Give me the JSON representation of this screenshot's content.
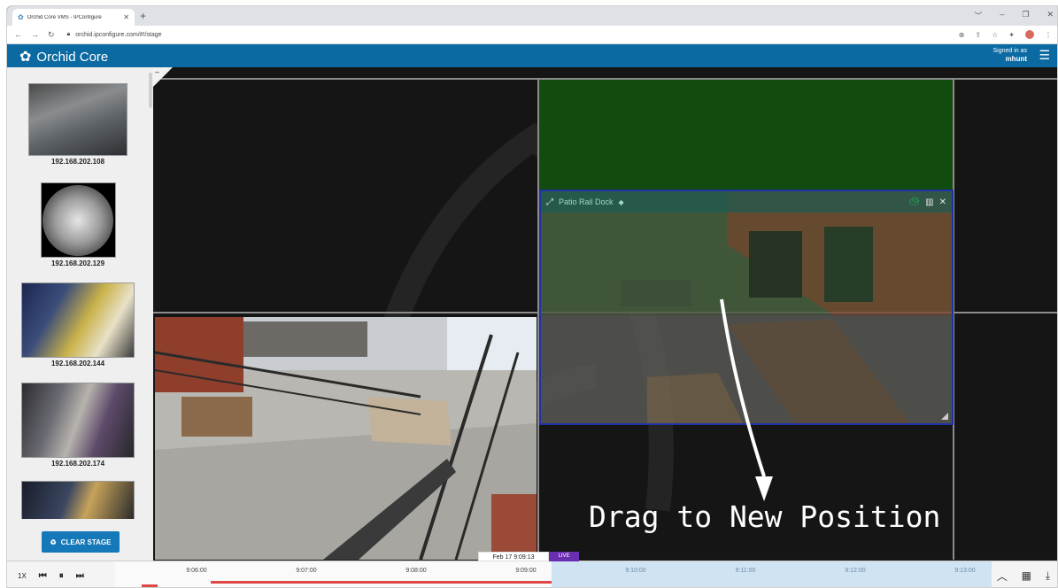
{
  "browser": {
    "tab_title": "Orchid Core VMS - IPConfigure",
    "url": "orchid.ipconfigure.com/#!/stage"
  },
  "header": {
    "brand": "Orchid Core",
    "signed_in_label": "Signed in as",
    "username": "mhunt"
  },
  "sidebar": {
    "cameras": [
      {
        "label": "192.168.202.108"
      },
      {
        "label": "192.168.202.129"
      },
      {
        "label": "192.168.202.144"
      },
      {
        "label": "192.168.202.174"
      },
      {
        "label": ""
      }
    ],
    "clear_stage_label": "CLEAR STAGE"
  },
  "stage": {
    "drag_tile_title": "Patio Rail Dock",
    "annotation": "Drag to New Position"
  },
  "timeline": {
    "speed": "1X",
    "current_datetime": "Feb 17 9:09:13",
    "live_label": "LIVE",
    "ticks": [
      "9:06:00",
      "9:07:00",
      "9:08:00",
      "9:09:00",
      "9:10:00",
      "9:11:00",
      "9:12:00",
      "9:13:00"
    ]
  },
  "colors": {
    "header_bg": "#0b6aa2",
    "live_badge": "#6a2fb0",
    "drop_zone": "#124b0f",
    "drag_border": "#2030a8"
  }
}
